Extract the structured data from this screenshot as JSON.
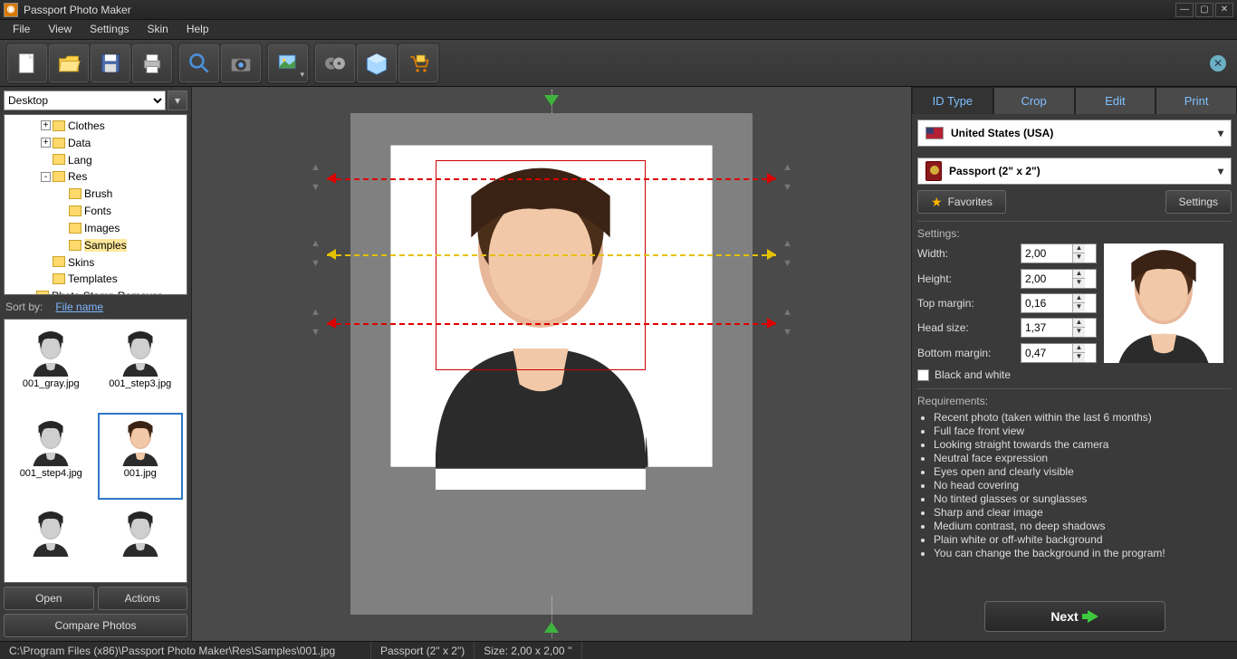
{
  "title": "Passport Photo Maker",
  "menu": [
    "File",
    "View",
    "Settings",
    "Skin",
    "Help"
  ],
  "location": {
    "value": "Desktop"
  },
  "tree": [
    {
      "indent": 2,
      "tog": "+",
      "label": "Clothes"
    },
    {
      "indent": 2,
      "tog": "+",
      "label": "Data"
    },
    {
      "indent": 2,
      "tog": "",
      "label": "Lang"
    },
    {
      "indent": 2,
      "tog": "-",
      "label": "Res"
    },
    {
      "indent": 3,
      "tog": "",
      "label": "Brush"
    },
    {
      "indent": 3,
      "tog": "",
      "label": "Fonts"
    },
    {
      "indent": 3,
      "tog": "",
      "label": "Images"
    },
    {
      "indent": 3,
      "tog": "",
      "label": "Samples",
      "sel": true
    },
    {
      "indent": 2,
      "tog": "",
      "label": "Skins"
    },
    {
      "indent": 2,
      "tog": "",
      "label": "Templates"
    },
    {
      "indent": 1,
      "tog": "",
      "label": "Photo Stamp Remover"
    }
  ],
  "sort": {
    "label": "Sort by:",
    "link": "File name"
  },
  "thumbs": [
    {
      "name": "001_gray.jpg"
    },
    {
      "name": "001_step3.jpg"
    },
    {
      "name": "001_step4.jpg"
    },
    {
      "name": "001.jpg",
      "sel": true
    },
    {
      "name": ""
    },
    {
      "name": ""
    }
  ],
  "buttons": {
    "open": "Open",
    "actions": "Actions",
    "compare": "Compare Photos"
  },
  "tabs": [
    "ID Type",
    "Crop",
    "Edit",
    "Print"
  ],
  "country": "United States (USA)",
  "doctype": "Passport (2\" x 2\")",
  "favorites": "Favorites",
  "settingsBtn": "Settings",
  "settingsHead": "Settings:",
  "fields": {
    "width_l": "Width:",
    "width_v": "2,00",
    "height_l": "Height:",
    "height_v": "2,00",
    "top_l": "Top margin:",
    "top_v": "0,16",
    "head_l": "Head size:",
    "head_v": "1,37",
    "bottom_l": "Bottom margin:",
    "bottom_v": "0,47"
  },
  "bw": "Black and white",
  "reqHead": "Requirements:",
  "requirements": [
    "Recent photo (taken within the last 6 months)",
    "Full face front view",
    "Looking straight towards the camera",
    "Neutral face expression",
    "Eyes open and clearly visible",
    "No head covering",
    "No tinted glasses or sunglasses",
    "Sharp and clear image",
    "Medium contrast, no deep shadows",
    "Plain white or off-white background",
    "You can change the background in the program!"
  ],
  "next": "Next",
  "status": {
    "path": "C:\\Program Files (x86)\\Passport Photo Maker\\Res\\Samples\\001.jpg",
    "type": "Passport (2\" x 2\")",
    "size": "Size: 2,00 x 2,00 ''"
  }
}
